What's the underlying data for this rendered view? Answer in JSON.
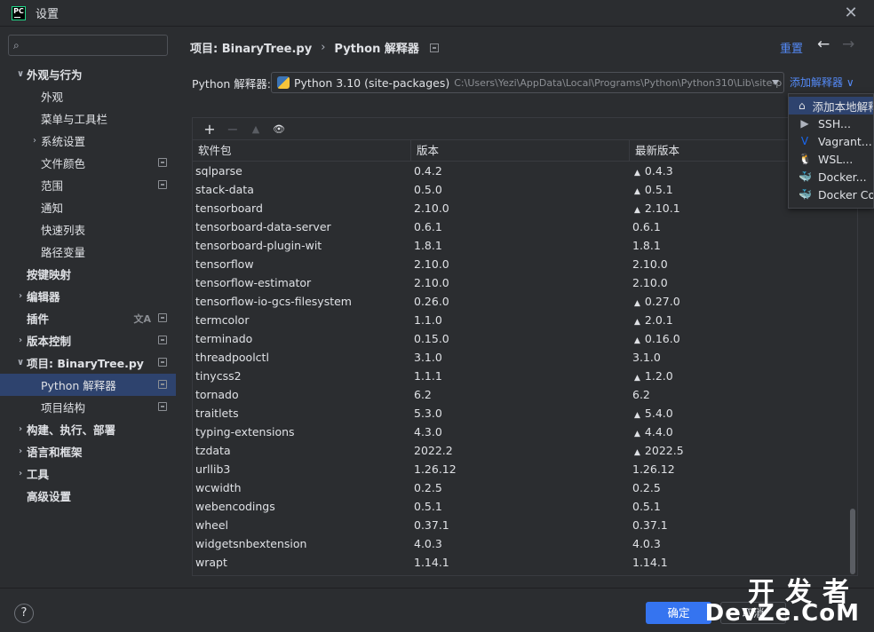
{
  "window": {
    "title": "设置",
    "close_glyph": "✕"
  },
  "search": {
    "placeholder": "",
    "icon": "search-icon"
  },
  "tree": [
    {
      "label": "外观与行为",
      "level": 0,
      "chevron": "∨",
      "bold": true
    },
    {
      "label": "外观",
      "level": 1
    },
    {
      "label": "菜单与工具栏",
      "level": 1
    },
    {
      "label": "系统设置",
      "level": 1,
      "chevron": "›"
    },
    {
      "label": "文件颜色",
      "level": 1,
      "trail": true
    },
    {
      "label": "范围",
      "level": 1,
      "trail": true
    },
    {
      "label": "通知",
      "level": 1
    },
    {
      "label": "快速列表",
      "level": 1
    },
    {
      "label": "路径变量",
      "level": 1
    },
    {
      "label": "按键映射",
      "level": 0,
      "bold": true
    },
    {
      "label": "编辑器",
      "level": 0,
      "chevron": "›",
      "bold": true
    },
    {
      "label": "插件",
      "level": 0,
      "bold": true,
      "trail": true,
      "translate": "文A"
    },
    {
      "label": "版本控制",
      "level": 0,
      "chevron": "›",
      "bold": true,
      "trail": true
    },
    {
      "label": "项目: BinaryTree.py",
      "level": 0,
      "chevron": "∨",
      "bold": true,
      "trail": true
    },
    {
      "label": "Python 解释器",
      "level": 1,
      "selected": true,
      "trail": true
    },
    {
      "label": "项目结构",
      "level": 1,
      "trail": true
    },
    {
      "label": "构建、执行、部署",
      "level": 0,
      "chevron": "›",
      "bold": true
    },
    {
      "label": "语言和框架",
      "level": 0,
      "chevron": "›",
      "bold": true
    },
    {
      "label": "工具",
      "level": 0,
      "chevron": "›",
      "bold": true
    },
    {
      "label": "高级设置",
      "level": 0,
      "bold": true
    }
  ],
  "breadcrumb": {
    "project": "项目: BinaryTree.py",
    "separator": "›",
    "page": "Python 解释器"
  },
  "header": {
    "reset": "重置",
    "back": "←",
    "forward": "→"
  },
  "interpreter": {
    "label": "Python 解释器:",
    "name": "Python 3.10 (site-packages)",
    "path": "C:\\Users\\Yezi\\AppData\\Local\\Programs\\Python\\Python310\\Lib\\site-p",
    "add_label": "添加解释器 ∨"
  },
  "toolbar": {
    "add": "+",
    "remove": "−",
    "upgrade": "▲",
    "show": "👁"
  },
  "table": {
    "headers": [
      "软件包",
      "版本",
      "最新版本"
    ],
    "rows": [
      {
        "name": "sqlparse",
        "version": "0.4.2",
        "latest": "0.4.3",
        "up": true
      },
      {
        "name": "stack-data",
        "version": "0.5.0",
        "latest": "0.5.1",
        "up": true
      },
      {
        "name": "tensorboard",
        "version": "2.10.0",
        "latest": "2.10.1",
        "up": true
      },
      {
        "name": "tensorboard-data-server",
        "version": "0.6.1",
        "latest": "0.6.1",
        "up": false
      },
      {
        "name": "tensorboard-plugin-wit",
        "version": "1.8.1",
        "latest": "1.8.1",
        "up": false
      },
      {
        "name": "tensorflow",
        "version": "2.10.0",
        "latest": "2.10.0",
        "up": false
      },
      {
        "name": "tensorflow-estimator",
        "version": "2.10.0",
        "latest": "2.10.0",
        "up": false
      },
      {
        "name": "tensorflow-io-gcs-filesystem",
        "version": "0.26.0",
        "latest": "0.27.0",
        "up": true
      },
      {
        "name": "termcolor",
        "version": "1.1.0",
        "latest": "2.0.1",
        "up": true
      },
      {
        "name": "terminado",
        "version": "0.15.0",
        "latest": "0.16.0",
        "up": true
      },
      {
        "name": "threadpoolctl",
        "version": "3.1.0",
        "latest": "3.1.0",
        "up": false
      },
      {
        "name": "tinycss2",
        "version": "1.1.1",
        "latest": "1.2.0",
        "up": true
      },
      {
        "name": "tornado",
        "version": "6.2",
        "latest": "6.2",
        "up": false
      },
      {
        "name": "traitlets",
        "version": "5.3.0",
        "latest": "5.4.0",
        "up": true
      },
      {
        "name": "typing-extensions",
        "version": "4.3.0",
        "latest": "4.4.0",
        "up": true
      },
      {
        "name": "tzdata",
        "version": "2022.2",
        "latest": "2022.5",
        "up": true
      },
      {
        "name": "urllib3",
        "version": "1.26.12",
        "latest": "1.26.12",
        "up": false
      },
      {
        "name": "wcwidth",
        "version": "0.2.5",
        "latest": "0.2.5",
        "up": false
      },
      {
        "name": "webencodings",
        "version": "0.5.1",
        "latest": "0.5.1",
        "up": false
      },
      {
        "name": "wheel",
        "version": "0.37.1",
        "latest": "0.37.1",
        "up": false
      },
      {
        "name": "widgetsnbextension",
        "version": "4.0.3",
        "latest": "4.0.3",
        "up": false
      },
      {
        "name": "wrapt",
        "version": "1.14.1",
        "latest": "1.14.1",
        "up": false
      }
    ]
  },
  "dropdown": [
    {
      "label": "添加本地解释器",
      "icon": "⌂",
      "icon_name": "home-icon",
      "color": "#dfe1e5",
      "active": true
    },
    {
      "label": "SSH...",
      "icon": "▶",
      "icon_name": "terminal-icon",
      "color": "#aeb3bd"
    },
    {
      "label": "Vagrant...",
      "icon": "V",
      "icon_name": "vagrant-icon",
      "color": "#1868f2"
    },
    {
      "label": "WSL...",
      "icon": "🐧",
      "icon_name": "linux-icon",
      "color": "#dfe1e5"
    },
    {
      "label": "Docker...",
      "icon": "🐳",
      "icon_name": "docker-icon",
      "color": "#2396ed"
    },
    {
      "label": "Docker Compose...",
      "icon": "🐳",
      "icon_name": "docker-compose-icon",
      "color": "#2396ed"
    }
  ],
  "footer": {
    "help": "?",
    "ok": "确定",
    "cancel": "取消"
  },
  "watermark": {
    "cn": "开发者",
    "en": "DevZe.CoM"
  },
  "colors": {
    "accent": "#3574f0",
    "link": "#548af7",
    "selection": "#2e436e",
    "bg": "#2b2d30"
  }
}
